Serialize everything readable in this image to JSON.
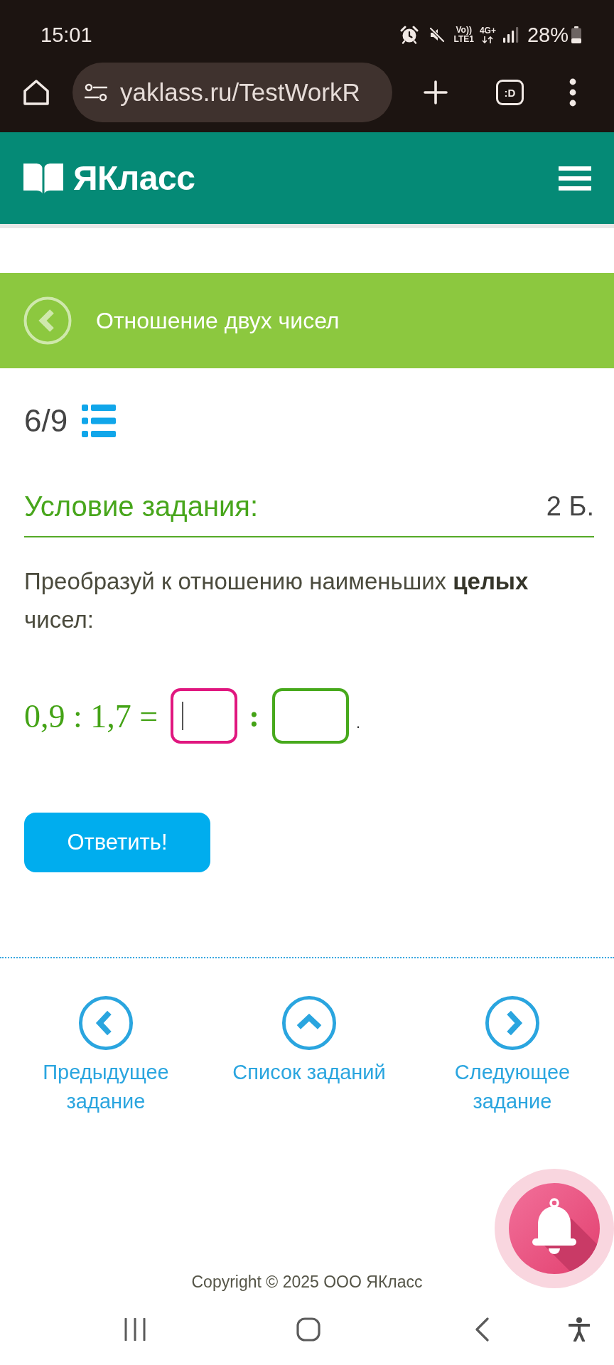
{
  "status_bar": {
    "time": "15:01",
    "volte": [
      "Vo))",
      "LTE1"
    ],
    "network_type": "4G+",
    "battery": "28%"
  },
  "browser": {
    "url": "yaklass.ru/TestWorkR",
    "tab_switcher": ":D"
  },
  "header": {
    "logo": "ЯКласс"
  },
  "topic": {
    "title": "Отношение двух чисел"
  },
  "task": {
    "counter": "6/9",
    "heading": "Условие задания:",
    "points": "2 Б.",
    "instruction": "Преобразуй к отношению наименьших **целых** чисел:",
    "equation": {
      "left": "0,9 : 1,7 =",
      "separator": ":",
      "end": "."
    },
    "answer_fields": [
      {
        "focused": true
      },
      {
        "focused": false
      }
    ],
    "submit": "Ответить!"
  },
  "navigation": [
    {
      "kind": "previous",
      "label": "Предыдущее задание"
    },
    {
      "kind": "list",
      "label": "Список заданий"
    },
    {
      "kind": "next",
      "label": "Следующее задание"
    }
  ],
  "footer": {
    "copyright": "Copyright © 2025 ООО ЯКласс"
  }
}
